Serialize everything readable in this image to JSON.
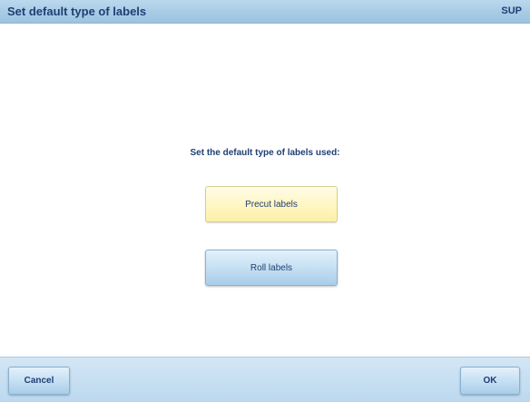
{
  "header": {
    "title": "Set default type of labels",
    "mode": "SUP"
  },
  "main": {
    "prompt": "Set the default type of labels used:",
    "options": [
      {
        "label": "Precut labels",
        "selected": true
      },
      {
        "label": "Roll labels",
        "selected": false
      }
    ]
  },
  "footer": {
    "cancel_label": "Cancel",
    "ok_label": "OK"
  },
  "colors": {
    "header_bar": "#a9cce6",
    "text": "#1f3f73",
    "selected_option": "#fff7c8",
    "button": "#c6e0f3"
  }
}
